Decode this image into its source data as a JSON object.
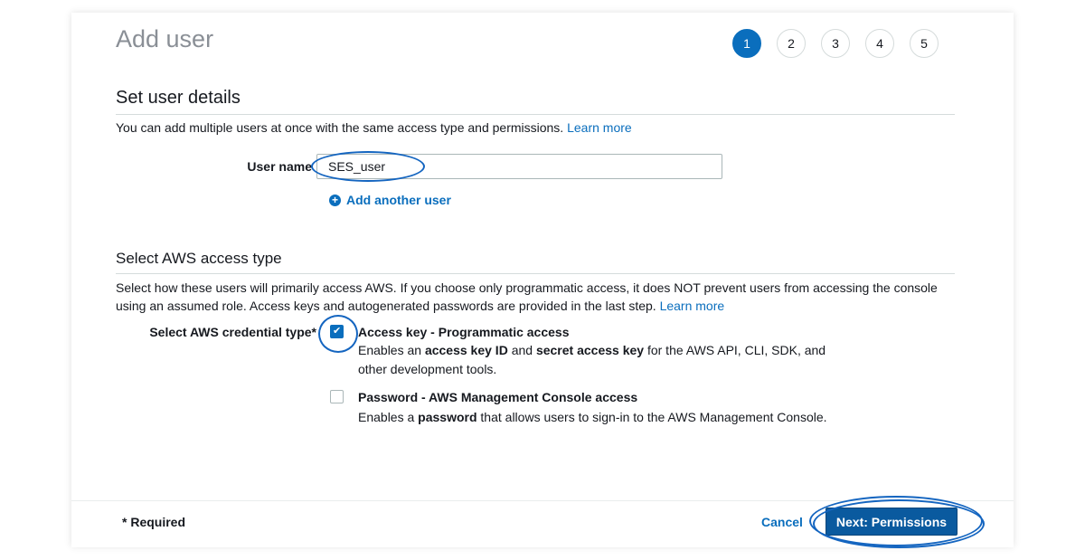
{
  "page": {
    "title": "Add user"
  },
  "steps": [
    "1",
    "2",
    "3",
    "4",
    "5"
  ],
  "set_user_details": {
    "heading": "Set user details",
    "description": "You can add multiple users at once with the same access type and permissions.",
    "learn_more": "Learn more",
    "user_name_label": "User name",
    "user_name_value": "SES_user",
    "add_another_user": "Add another user"
  },
  "access_type": {
    "heading": "Select AWS access type",
    "description": "Select how these users will primarily access AWS. If you choose only programmatic access, it does NOT prevent users from accessing the console using an assumed role. Access keys and autogenerated passwords are provided in the last step.",
    "learn_more": "Learn more",
    "credential_label": "Select AWS credential type*",
    "options": [
      {
        "title": "Access key - Programmatic access",
        "checked": true,
        "desc_parts": [
          "Enables an ",
          "access key ID",
          " and ",
          "secret access key",
          " for the AWS API, CLI, SDK, and other development tools."
        ]
      },
      {
        "title": "Password - AWS Management Console access",
        "checked": false,
        "desc_parts": [
          "Enables a ",
          "password",
          " that allows users to sign-in to the AWS Management Console."
        ]
      }
    ]
  },
  "footer": {
    "required": "* Required",
    "cancel": "Cancel",
    "next": "Next: Permissions"
  },
  "colors": {
    "accent": "#0a6ebd",
    "button": "#0a5a9f",
    "annotation": "#1465c0"
  }
}
